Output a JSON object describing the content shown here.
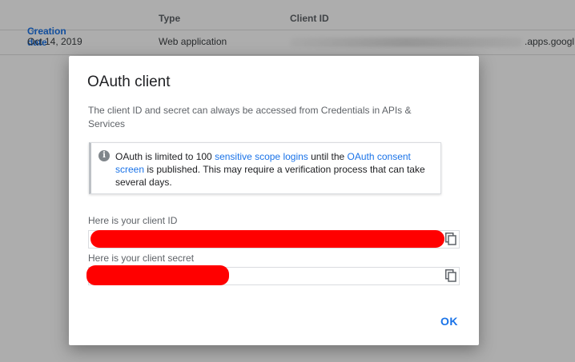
{
  "table": {
    "columns": {
      "creation_date": "Creation date",
      "type": "Type",
      "client_id": "Client ID"
    },
    "row": {
      "date": "Oct 14, 2019",
      "type": "Web application",
      "client_suffix": ".apps.googl"
    }
  },
  "dialog": {
    "title": "OAuth client",
    "description": "The client ID and secret can always be accessed from Credentials in APIs & Services",
    "info": {
      "text_before": "OAuth is limited to 100 ",
      "link_logins": "sensitive scope logins",
      "text_middle": " until the ",
      "link_consent": "OAuth consent screen",
      "text_after": " is published. This may require a verification process that can take several days."
    },
    "client_id_label": "Here is your client ID",
    "client_secret_label": "Here is your client secret",
    "ok_label": "OK"
  },
  "colors": {
    "accent": "#1a73e8",
    "redaction": "#ff0000"
  },
  "icons": {
    "sort": "chevron-down-icon",
    "info": "info-icon",
    "copy": "copy-icon"
  }
}
